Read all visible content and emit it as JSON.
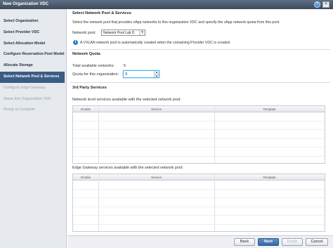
{
  "window": {
    "title": "New Organization VDC"
  },
  "steps": [
    {
      "label": "Select Organization",
      "state": "done"
    },
    {
      "label": "Select Provider VDC",
      "state": "done"
    },
    {
      "label": "Select Allocation Model",
      "state": "done"
    },
    {
      "label": "Configure Reservation Pool Model",
      "state": "done"
    },
    {
      "label": "Allocate Storage",
      "state": "done"
    },
    {
      "label": "Select Network Pool & Services",
      "state": "active"
    },
    {
      "label": "Configure Edge Gateway",
      "state": "disabled"
    },
    {
      "label": "Name this Organization VDC",
      "state": "disabled"
    },
    {
      "label": "Ready to Complete",
      "state": "disabled"
    }
  ],
  "main": {
    "heading": "Select Network Pool & Services",
    "description": "Select the network pool that provides vApp networks to this organization VDC and specify the vApp network quota from this pool.",
    "network_pool_label": "Network pool:",
    "network_pool_value": "Network Pool Lab D",
    "info_text": "A VXLAN network pool is automatically created when the containing Provider VDC is created.",
    "quota_heading": "Network Quota",
    "total_label": "Total available networks:",
    "total_value": "5",
    "quota_label": "Quota for this organization:",
    "quota_value": "3",
    "third_party_heading": "3rd Party Services",
    "network_services_label": "Network level services available with the selected network pool:",
    "edge_services_label": "Edge Gateway services available with the selected network pool:",
    "table_columns": [
      "Enable",
      "Service",
      "Template"
    ]
  },
  "footer": {
    "back": "Back",
    "next": "Next",
    "finish": "Finish",
    "cancel": "Cancel"
  },
  "colors": {
    "active_step": "#3b5c84",
    "titlebar": "#3d4a5c",
    "primary_button": "#3b6aa3"
  }
}
